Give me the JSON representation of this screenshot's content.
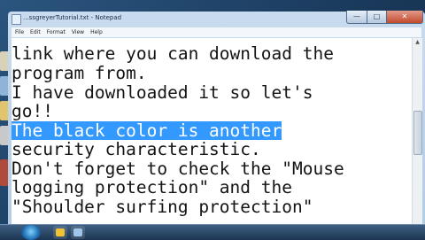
{
  "window": {
    "title": "...ssgreyerTutorial.txt - Notepad"
  },
  "menu": {
    "items": [
      "File",
      "Edit",
      "Format",
      "View",
      "Help"
    ]
  },
  "editor": {
    "lines": [
      "link where you can download the",
      "program from.",
      "I have downloaded it so let's",
      "go!!",
      "The black color is another",
      "security characteristic.",
      "Don't forget to check the \"Mouse",
      "logging protection\" and the",
      "\"Shoulder surfing protection\""
    ],
    "selected_line_index": 4
  },
  "colors": {
    "selection": "#3399ff",
    "desktop": "#1a3a5c",
    "close_button": "#c34a2c"
  }
}
